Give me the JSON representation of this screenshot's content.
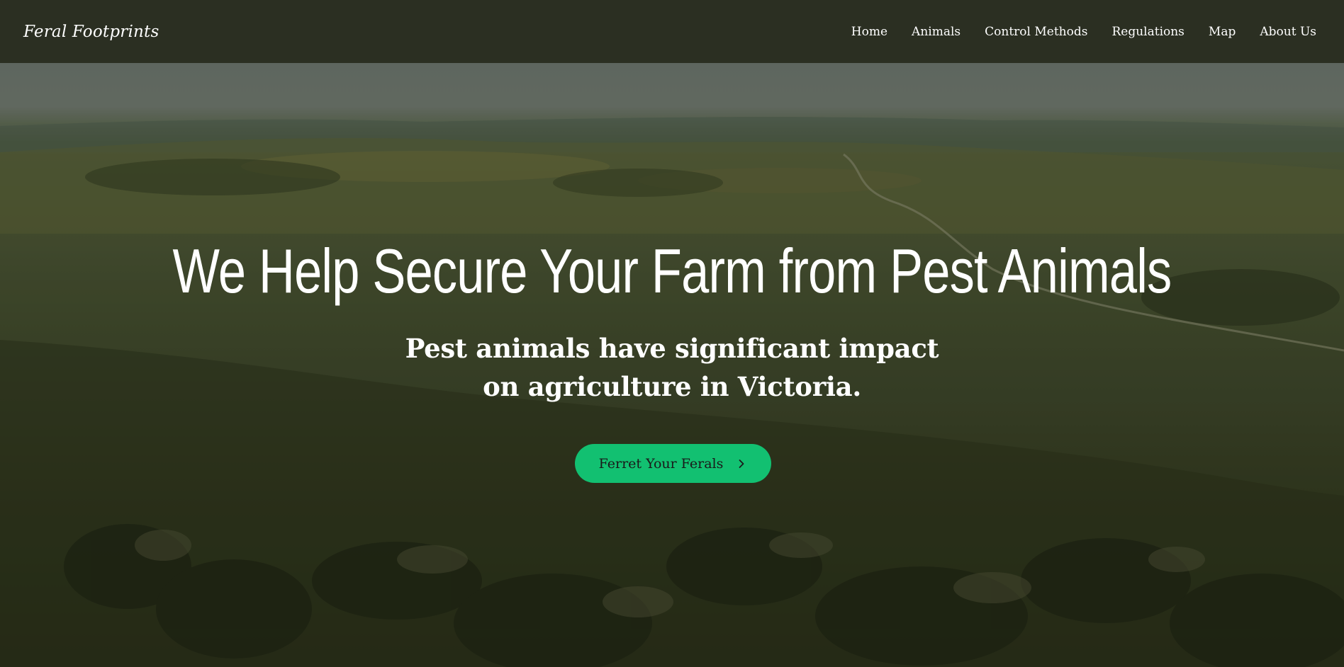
{
  "brand": {
    "name": "Feral Footprints"
  },
  "nav": {
    "items": [
      {
        "label": "Home"
      },
      {
        "label": "Animals"
      },
      {
        "label": "Control Methods"
      },
      {
        "label": "Regulations"
      },
      {
        "label": "Map"
      },
      {
        "label": "About Us"
      }
    ]
  },
  "hero": {
    "title": "We Help Secure Your Farm from Pest Animals",
    "subtitle": "Pest animals have significant impact on agriculture in Victoria.",
    "cta_label": "Ferret Your Ferals",
    "cta_icon": "chevron-right-icon"
  },
  "colors": {
    "navbar_bg": "#2b2f22",
    "cta_bg": "#12c071",
    "text": "#ffffff"
  }
}
